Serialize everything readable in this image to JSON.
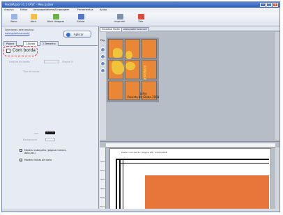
{
  "window": {
    "title": "PosteRazor v1.1 FAST - Meu poster",
    "close_label": "x"
  },
  "menu": [
    "Arquivo",
    "Editar",
    "Language/Idioma/Linguagem",
    "Ferramentas",
    "Ajuda"
  ],
  "toolbar": [
    {
      "label": "Novo",
      "icon": "new-document-icon",
      "color": "#9bb6e6"
    },
    {
      "label": "Abrir",
      "icon": "open-folder-icon",
      "color": "#f0c14a"
    },
    {
      "label": "Abrir imagem",
      "icon": "open-image-icon",
      "color": "#6bb04b"
    },
    {
      "label": "Salvar",
      "icon": "save-icon",
      "color": "#5677c9"
    },
    {
      "label": "Imprimir",
      "icon": "printer-icon",
      "color": "#7f8fa8"
    },
    {
      "label": "Sair",
      "icon": "exit-icon",
      "color": "#d94b3a"
    }
  ],
  "left_panel": {
    "source_label": "Selecionou este arquivo:",
    "source_link": "www.guiaferramenta",
    "apply_label": "Aplicar",
    "tabs": [
      "Página",
      "1.Borda",
      "2.Tamanho"
    ],
    "border_checkbox_label": "Com borda",
    "border_width_label": "Largura da borda:",
    "border_width_unit": "Alegua %",
    "border_type_label": "Tipo de borda:",
    "color_label": "cor:",
    "background_label": "Background",
    "option_1": "Mostrar cabeçalho (página:número, data,etc.)",
    "option_2": "Mostrar linhas de corte"
  },
  "preview": {
    "tabs": [
      "Visualizar Poster",
      "www.posterrazor.com"
    ],
    "page_label": "Pág.",
    "poster_text_1": "Julho",
    "poster_text_2": "Revista do Globo 2008",
    "poster_side_text": "FOREVER",
    "page_header_text": "Poster com borda  - página 1/6 - 12/05/2008",
    "ruler_marks": [
      "1cm",
      "2cm",
      "3cm",
      "4cm",
      "5cm",
      "6cm"
    ]
  },
  "colors": {
    "accent": "#2d5cb8",
    "poster_orange": "#e98737",
    "poster_yellow": "#f0c43a",
    "highlight": "#d93a2a"
  }
}
